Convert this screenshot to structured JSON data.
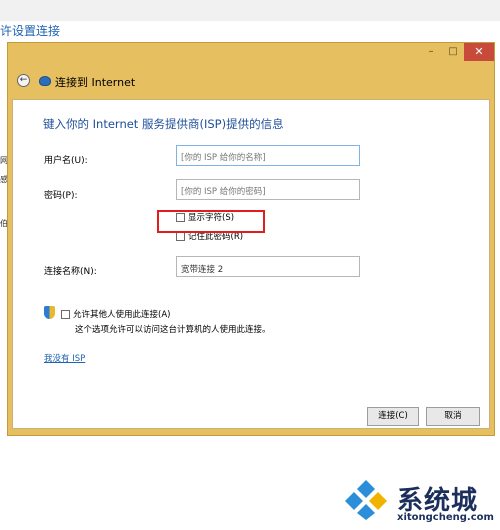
{
  "background": {
    "title": "许设置连接",
    "side_chars": [
      "网",
      "感",
      "伯"
    ]
  },
  "window_controls": {
    "minimize": "–",
    "maximize": "□",
    "close": "✕"
  },
  "nav": {
    "back_icon": "back-arrow-icon",
    "title": "连接到 Internet"
  },
  "heading": "键入你的 Internet 服务提供商(ISP)提供的信息",
  "form": {
    "username_label": "用户名(U):",
    "username_placeholder": "[你的 ISP 给你的名称]",
    "password_label": "密码(P):",
    "password_placeholder": "[你的 ISP 给你的密码]",
    "show_chars_label": "显示字符(S)",
    "remember_label": "记住此密码(R)",
    "conn_name_label": "连接名称(N):",
    "conn_name_value": "宽带连接 2"
  },
  "allow": {
    "label": "允许其他人使用此连接(A)",
    "description": "这个选项允许可以访问这台计算机的人使用此连接。"
  },
  "no_isp_link": "我没有 ISP",
  "buttons": {
    "connect": "连接(C)",
    "cancel": "取消"
  },
  "watermark": {
    "text": "系统城",
    "url": "xitongcheng.com"
  },
  "colors": {
    "frame": "#e5bf60",
    "heading": "#1e4f9a",
    "link": "#1e62b0",
    "highlight": "#e01e1e"
  }
}
